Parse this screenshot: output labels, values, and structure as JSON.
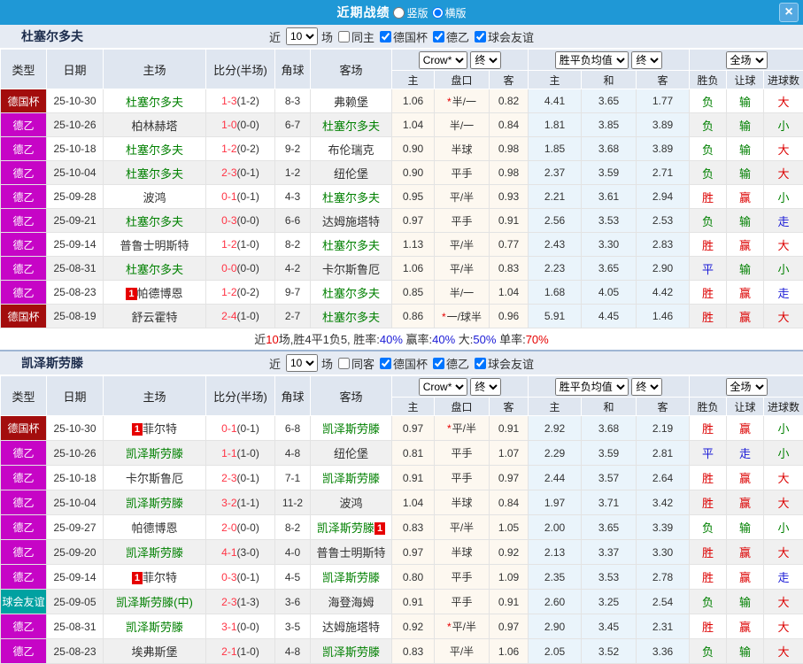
{
  "titlebar": {
    "title": "近期战绩",
    "radios": [
      {
        "label": "竖版",
        "selected": false
      },
      {
        "label": "横版",
        "selected": true
      }
    ],
    "close_label": "×"
  },
  "table_header": {
    "type": "类型",
    "date": "日期",
    "home": "主场",
    "score": "比分(半场)",
    "corners": "角球",
    "away": "客场",
    "asian_select": "Crow*",
    "asian_final_select": "终",
    "asian_sub": {
      "home": "主",
      "handicap": "盘口",
      "away": "客"
    },
    "euro_select": "胜平负均值",
    "euro_final_select": "终",
    "euro_sub": {
      "home": "主",
      "draw": "和",
      "away": "客"
    },
    "scope_select": "全场",
    "result_sub": {
      "wdl": "胜负",
      "handicap": "让球",
      "goals": "进球数"
    }
  },
  "colors": {
    "league": {
      "德国杯": "#A30D0D",
      "德乙": "#C605C6",
      "球会友谊": "#00A1A1"
    },
    "outcome": {
      "red": "#DC0000",
      "green": "#008000",
      "blue": "#1A1AD6"
    },
    "summary": {
      "dark": "#333333",
      "red": "#E60000",
      "blue": "#1A1AD6"
    },
    "titlebar": "#1F98D6"
  },
  "sections": [
    {
      "team": "杜塞尔多夫",
      "controls": {
        "near": "近",
        "count": "10",
        "games": "场",
        "same_label": "同主",
        "same_checked": false,
        "filters": [
          {
            "label": "德国杯",
            "checked": true
          },
          {
            "label": "德乙",
            "checked": true
          },
          {
            "label": "球会友谊",
            "checked": true
          }
        ]
      },
      "rows": [
        {
          "league": "德国杯",
          "date": "25-10-30",
          "home": {
            "name": "杜塞尔多夫",
            "green": true
          },
          "ft": "1-3",
          "ht": "(1-2)",
          "corners": "8-3",
          "away": {
            "name": "弗赖堡",
            "green": false
          },
          "ah": "1.06",
          "hc": "半/一",
          "star": true,
          "aa": "0.82",
          "eh": "4.41",
          "ed": "3.65",
          "ea": "1.77",
          "o": [
            [
              "负",
              "green"
            ],
            [
              "输",
              "green"
            ],
            [
              "大",
              "red"
            ]
          ]
        },
        {
          "league": "德乙",
          "date": "25-10-26",
          "home": {
            "name": "柏林赫塔",
            "green": false
          },
          "ft": "1-0",
          "ht": "(0-0)",
          "corners": "6-7",
          "away": {
            "name": "杜塞尔多夫",
            "green": true
          },
          "ah": "1.04",
          "hc": "半/一",
          "star": false,
          "aa": "0.84",
          "eh": "1.81",
          "ed": "3.85",
          "ea": "3.89",
          "o": [
            [
              "负",
              "green"
            ],
            [
              "输",
              "green"
            ],
            [
              "小",
              "green"
            ]
          ]
        },
        {
          "league": "德乙",
          "date": "25-10-18",
          "home": {
            "name": "杜塞尔多夫",
            "green": true
          },
          "ft": "1-2",
          "ht": "(0-2)",
          "corners": "9-2",
          "away": {
            "name": "布伦瑞克",
            "green": false
          },
          "ah": "0.90",
          "hc": "半球",
          "star": false,
          "aa": "0.98",
          "eh": "1.85",
          "ed": "3.68",
          "ea": "3.89",
          "o": [
            [
              "负",
              "green"
            ],
            [
              "输",
              "green"
            ],
            [
              "大",
              "red"
            ]
          ]
        },
        {
          "league": "德乙",
          "date": "25-10-04",
          "home": {
            "name": "杜塞尔多夫",
            "green": true
          },
          "ft": "2-3",
          "ht": "(0-1)",
          "corners": "1-2",
          "away": {
            "name": "纽伦堡",
            "green": false
          },
          "ah": "0.90",
          "hc": "平手",
          "star": false,
          "aa": "0.98",
          "eh": "2.37",
          "ed": "3.59",
          "ea": "2.71",
          "o": [
            [
              "负",
              "green"
            ],
            [
              "输",
              "green"
            ],
            [
              "大",
              "red"
            ]
          ]
        },
        {
          "league": "德乙",
          "date": "25-09-28",
          "home": {
            "name": "波鸿",
            "green": false
          },
          "ft": "0-1",
          "ht": "(0-1)",
          "corners": "4-3",
          "away": {
            "name": "杜塞尔多夫",
            "green": true
          },
          "ah": "0.95",
          "hc": "平/半",
          "star": false,
          "aa": "0.93",
          "eh": "2.21",
          "ed": "3.61",
          "ea": "2.94",
          "o": [
            [
              "胜",
              "red"
            ],
            [
              "赢",
              "red"
            ],
            [
              "小",
              "green"
            ]
          ]
        },
        {
          "league": "德乙",
          "date": "25-09-21",
          "home": {
            "name": "杜塞尔多夫",
            "green": true
          },
          "ft": "0-3",
          "ht": "(0-0)",
          "corners": "6-6",
          "away": {
            "name": "达姆施塔特",
            "green": false
          },
          "ah": "0.97",
          "hc": "平手",
          "star": false,
          "aa": "0.91",
          "eh": "2.56",
          "ed": "3.53",
          "ea": "2.53",
          "o": [
            [
              "负",
              "green"
            ],
            [
              "输",
              "green"
            ],
            [
              "走",
              "blue"
            ]
          ]
        },
        {
          "league": "德乙",
          "date": "25-09-14",
          "home": {
            "name": "普鲁士明斯特",
            "green": false
          },
          "ft": "1-2",
          "ht": "(1-0)",
          "corners": "8-2",
          "away": {
            "name": "杜塞尔多夫",
            "green": true
          },
          "ah": "1.13",
          "hc": "平/半",
          "star": false,
          "aa": "0.77",
          "eh": "2.43",
          "ed": "3.30",
          "ea": "2.83",
          "o": [
            [
              "胜",
              "red"
            ],
            [
              "赢",
              "red"
            ],
            [
              "大",
              "red"
            ]
          ]
        },
        {
          "league": "德乙",
          "date": "25-08-31",
          "home": {
            "name": "杜塞尔多夫",
            "green": true
          },
          "ft": "0-0",
          "ht": "(0-0)",
          "corners": "4-2",
          "away": {
            "name": "卡尔斯鲁厄",
            "green": false
          },
          "ah": "1.06",
          "hc": "平/半",
          "star": false,
          "aa": "0.83",
          "eh": "2.23",
          "ed": "3.65",
          "ea": "2.90",
          "o": [
            [
              "平",
              "blue"
            ],
            [
              "输",
              "green"
            ],
            [
              "小",
              "green"
            ]
          ]
        },
        {
          "league": "德乙",
          "date": "25-08-23",
          "home": {
            "name": "帕德博恩",
            "green": false,
            "badge": "1",
            "badge_pos": "before"
          },
          "ft": "1-2",
          "ht": "(0-2)",
          "corners": "9-7",
          "away": {
            "name": "杜塞尔多夫",
            "green": true
          },
          "ah": "0.85",
          "hc": "半/一",
          "star": false,
          "aa": "1.04",
          "eh": "1.68",
          "ed": "4.05",
          "ea": "4.42",
          "o": [
            [
              "胜",
              "red"
            ],
            [
              "赢",
              "red"
            ],
            [
              "走",
              "blue"
            ]
          ]
        },
        {
          "league": "德国杯",
          "date": "25-08-19",
          "home": {
            "name": "舒云霍特",
            "green": false
          },
          "ft": "2-4",
          "ht": "(1-0)",
          "corners": "2-7",
          "away": {
            "name": "杜塞尔多夫",
            "green": true
          },
          "ah": "0.86",
          "hc": "一/球半",
          "star": true,
          "aa": "0.96",
          "eh": "5.91",
          "ed": "4.45",
          "ea": "1.46",
          "o": [
            [
              "胜",
              "red"
            ],
            [
              "赢",
              "red"
            ],
            [
              "大",
              "red"
            ]
          ]
        }
      ],
      "summary": [
        [
          "近",
          "dark"
        ],
        [
          "10",
          "red"
        ],
        [
          "场,胜4平1负5, 胜率:",
          "dark"
        ],
        [
          "40%",
          "blue"
        ],
        [
          " 赢率:",
          "dark"
        ],
        [
          "40%",
          "blue"
        ],
        [
          " 大:",
          "dark"
        ],
        [
          "50%",
          "blue"
        ],
        [
          " 单率:",
          "dark"
        ],
        [
          "70%",
          "red"
        ]
      ]
    },
    {
      "team": "凯泽斯劳滕",
      "controls": {
        "near": "近",
        "count": "10",
        "games": "场",
        "same_label": "同客",
        "same_checked": false,
        "filters": [
          {
            "label": "德国杯",
            "checked": true
          },
          {
            "label": "德乙",
            "checked": true
          },
          {
            "label": "球会友谊",
            "checked": true
          }
        ]
      },
      "rows": [
        {
          "league": "德国杯",
          "date": "25-10-30",
          "home": {
            "name": "菲尔特",
            "green": false,
            "badge": "1",
            "badge_pos": "before"
          },
          "ft": "0-1",
          "ht": "(0-1)",
          "corners": "6-8",
          "away": {
            "name": "凯泽斯劳滕",
            "green": true
          },
          "ah": "0.97",
          "hc": "平/半",
          "star": true,
          "aa": "0.91",
          "eh": "2.92",
          "ed": "3.68",
          "ea": "2.19",
          "o": [
            [
              "胜",
              "red"
            ],
            [
              "赢",
              "red"
            ],
            [
              "小",
              "green"
            ]
          ]
        },
        {
          "league": "德乙",
          "date": "25-10-26",
          "home": {
            "name": "凯泽斯劳滕",
            "green": true
          },
          "ft": "1-1",
          "ht": "(1-0)",
          "corners": "4-8",
          "away": {
            "name": "纽伦堡",
            "green": false
          },
          "ah": "0.81",
          "hc": "平手",
          "star": false,
          "aa": "1.07",
          "eh": "2.29",
          "ed": "3.59",
          "ea": "2.81",
          "o": [
            [
              "平",
              "blue"
            ],
            [
              "走",
              "blue"
            ],
            [
              "小",
              "green"
            ]
          ]
        },
        {
          "league": "德乙",
          "date": "25-10-18",
          "home": {
            "name": "卡尔斯鲁厄",
            "green": false
          },
          "ft": "2-3",
          "ht": "(0-1)",
          "corners": "7-1",
          "away": {
            "name": "凯泽斯劳滕",
            "green": true
          },
          "ah": "0.91",
          "hc": "平手",
          "star": false,
          "aa": "0.97",
          "eh": "2.44",
          "ed": "3.57",
          "ea": "2.64",
          "o": [
            [
              "胜",
              "red"
            ],
            [
              "赢",
              "red"
            ],
            [
              "大",
              "red"
            ]
          ]
        },
        {
          "league": "德乙",
          "date": "25-10-04",
          "home": {
            "name": "凯泽斯劳滕",
            "green": true
          },
          "ft": "3-2",
          "ht": "(1-1)",
          "corners": "11-2",
          "away": {
            "name": "波鸿",
            "green": false
          },
          "ah": "1.04",
          "hc": "半球",
          "star": false,
          "aa": "0.84",
          "eh": "1.97",
          "ed": "3.71",
          "ea": "3.42",
          "o": [
            [
              "胜",
              "red"
            ],
            [
              "赢",
              "red"
            ],
            [
              "大",
              "red"
            ]
          ]
        },
        {
          "league": "德乙",
          "date": "25-09-27",
          "home": {
            "name": "帕德博恩",
            "green": false
          },
          "ft": "2-0",
          "ht": "(0-0)",
          "corners": "8-2",
          "away": {
            "name": "凯泽斯劳滕",
            "green": true,
            "badge": "1",
            "badge_pos": "after"
          },
          "ah": "0.83",
          "hc": "平/半",
          "star": false,
          "aa": "1.05",
          "eh": "2.00",
          "ed": "3.65",
          "ea": "3.39",
          "o": [
            [
              "负",
              "green"
            ],
            [
              "输",
              "green"
            ],
            [
              "小",
              "green"
            ]
          ]
        },
        {
          "league": "德乙",
          "date": "25-09-20",
          "home": {
            "name": "凯泽斯劳滕",
            "green": true
          },
          "ft": "4-1",
          "ht": "(3-0)",
          "corners": "4-0",
          "away": {
            "name": "普鲁士明斯特",
            "green": false
          },
          "ah": "0.97",
          "hc": "半球",
          "star": false,
          "aa": "0.92",
          "eh": "2.13",
          "ed": "3.37",
          "ea": "3.30",
          "o": [
            [
              "胜",
              "red"
            ],
            [
              "赢",
              "red"
            ],
            [
              "大",
              "red"
            ]
          ]
        },
        {
          "league": "德乙",
          "date": "25-09-14",
          "home": {
            "name": "菲尔特",
            "green": false,
            "badge": "1",
            "badge_pos": "before"
          },
          "ft": "0-3",
          "ht": "(0-1)",
          "corners": "4-5",
          "away": {
            "name": "凯泽斯劳滕",
            "green": true
          },
          "ah": "0.80",
          "hc": "平手",
          "star": false,
          "aa": "1.09",
          "eh": "2.35",
          "ed": "3.53",
          "ea": "2.78",
          "o": [
            [
              "胜",
              "red"
            ],
            [
              "赢",
              "red"
            ],
            [
              "走",
              "blue"
            ]
          ]
        },
        {
          "league": "球会友谊",
          "date": "25-09-05",
          "home": {
            "name": "凯泽斯劳滕(中)",
            "green": true
          },
          "ft": "2-3",
          "ht": "(1-3)",
          "corners": "3-6",
          "away": {
            "name": "海登海姆",
            "green": false
          },
          "ah": "0.91",
          "hc": "平手",
          "star": false,
          "aa": "0.91",
          "eh": "2.60",
          "ed": "3.25",
          "ea": "2.54",
          "o": [
            [
              "负",
              "green"
            ],
            [
              "输",
              "green"
            ],
            [
              "大",
              "red"
            ]
          ]
        },
        {
          "league": "德乙",
          "date": "25-08-31",
          "home": {
            "name": "凯泽斯劳滕",
            "green": true
          },
          "ft": "3-1",
          "ht": "(0-0)",
          "corners": "3-5",
          "away": {
            "name": "达姆施塔特",
            "green": false
          },
          "ah": "0.92",
          "hc": "平/半",
          "star": true,
          "aa": "0.97",
          "eh": "2.90",
          "ed": "3.45",
          "ea": "2.31",
          "o": [
            [
              "胜",
              "red"
            ],
            [
              "赢",
              "red"
            ],
            [
              "大",
              "red"
            ]
          ]
        },
        {
          "league": "德乙",
          "date": "25-08-23",
          "home": {
            "name": "埃弗斯堡",
            "green": false
          },
          "ft": "2-1",
          "ht": "(1-0)",
          "corners": "4-8",
          "away": {
            "name": "凯泽斯劳滕",
            "green": true
          },
          "ah": "0.83",
          "hc": "平/半",
          "star": false,
          "aa": "1.06",
          "eh": "2.05",
          "ed": "3.52",
          "ea": "3.36",
          "o": [
            [
              "负",
              "green"
            ],
            [
              "输",
              "green"
            ],
            [
              "大",
              "red"
            ]
          ]
        }
      ],
      "summary": null
    }
  ]
}
